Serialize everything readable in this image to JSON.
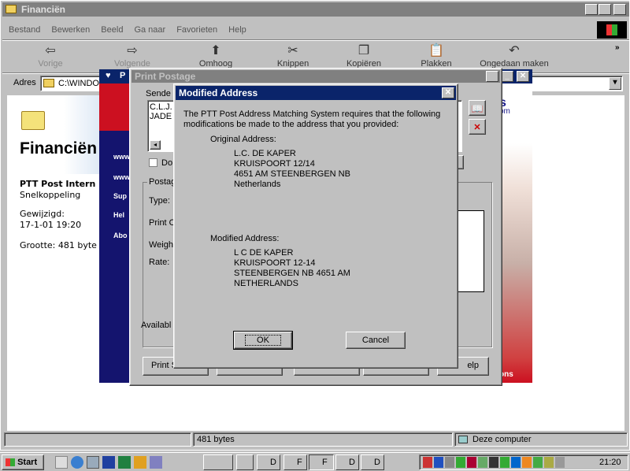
{
  "explorer": {
    "title": "Financiën",
    "menu": [
      "Bestand",
      "Bewerken",
      "Beeld",
      "Ga naar",
      "Favorieten",
      "Help"
    ],
    "toolbar": [
      "Vorige",
      "Volgende",
      "Omhoog",
      "Knippen",
      "Kopiëren",
      "Plakken",
      "Ongedaan maken"
    ],
    "address_label": "Adres",
    "address_value": "C:\\WINDOWS",
    "folder_heading": "Financiën",
    "item_name": "PTT Post Intern",
    "item_type": "Snelkoppeling",
    "modified_label": "Gewijzigd:",
    "modified_value": "17-1-01 19:20",
    "size_text": "Grootte: 481 byte",
    "status_size": "481 bytes",
    "status_zone": "Deze computer"
  },
  "ptt_app": {
    "links": [
      "www",
      "www",
      "Sup",
      "Hel",
      "Abo"
    ],
    "brand_suffix": "s",
    "brand_suffix2": "om",
    "footer_text": "ons"
  },
  "print_postage": {
    "title": "Print Postage",
    "sender_label": "Sende",
    "sender_lines": [
      "C.L.J.",
      "JADE"
    ],
    "checkbox_label": "Do",
    "postage_label": "Postag",
    "type_label": "Type:",
    "print_label": "Print O",
    "weight_label": "Weigh",
    "rate_label": "Rate:",
    "available_label": "Availabl",
    "print_button": "Print S",
    "help_button": "elp"
  },
  "dialog": {
    "title": "Modified Address",
    "message": "The PTT Post Address Matching System requires that the following modifications be made to the address that you provided:",
    "original_label": "Original Address:",
    "original_lines": [
      "L.C. DE KAPER",
      "KRUISPOORT 12/14",
      "4651 AM STEENBERGEN NB",
      "Netherlands"
    ],
    "modified_label": "Modified Address:",
    "modified_lines": [
      "L C DE KAPER",
      "KRUISPOORT 12-14",
      "STEENBERGEN NB 4651 AM",
      "NETHERLANDS"
    ],
    "ok_label": "OK",
    "cancel_label": "Cancel"
  },
  "taskbar": {
    "start_label": "Start",
    "tasks": [
      "",
      "",
      "D",
      "F",
      "F",
      "D",
      "D"
    ],
    "clock": "21:20"
  },
  "colors": {
    "titlebar_active": "#0a246a",
    "titlebar_inactive": "#808080",
    "ptt_blue": "#14146e",
    "ptt_red": "#cc1020",
    "desktop_gray": "#c0c0c0"
  }
}
